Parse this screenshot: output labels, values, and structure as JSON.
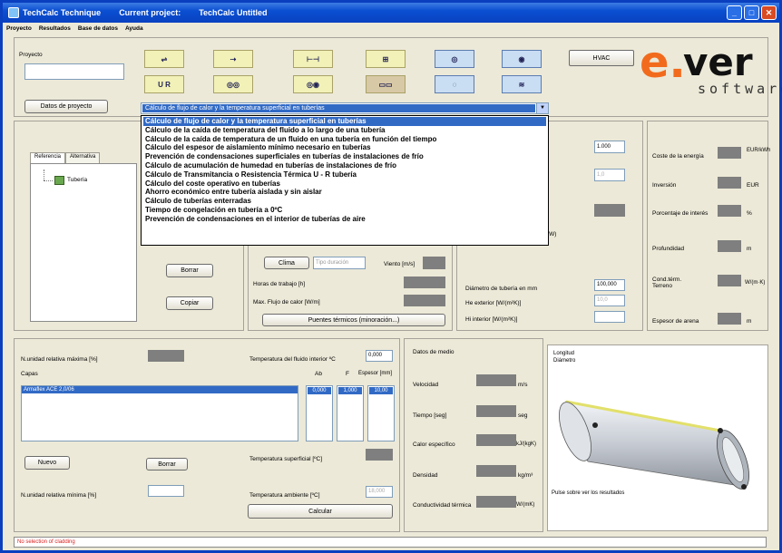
{
  "window": {
    "app_name": "TechCalc Technique",
    "project_label": "Current project:",
    "project_name": "TechCalc Untitled",
    "minimize": "_",
    "maximize": "□",
    "close": "✕"
  },
  "menu": [
    "Proyecto",
    "Resultados",
    "Base de datos",
    "Ayuda"
  ],
  "project": {
    "label": "Proyecto",
    "value": "",
    "data_button": "Datos de proyecto"
  },
  "toolbar": {
    "tools": [
      {
        "glyph": "⇌",
        "icon": "pipe-flow-icon"
      },
      {
        "glyph": "⇢",
        "icon": "pipe-arrow-icon"
      },
      {
        "glyph": "⊢⊣",
        "icon": "pipe-section-icon"
      },
      {
        "glyph": "⊞",
        "icon": "pipe-grid-icon"
      },
      {
        "glyph": "◎",
        "icon": "pipe-round-icon"
      },
      {
        "glyph": "◉",
        "icon": "pipe-ring-icon"
      },
      {
        "glyph": "U R",
        "icon": "ur-icon"
      },
      {
        "glyph": "◎◎",
        "icon": "double-pipe-icon"
      },
      {
        "glyph": "◎◉",
        "icon": "pipe-pair-icon"
      },
      {
        "glyph": "▭▭",
        "icon": "duct-icon"
      },
      {
        "glyph": "◌",
        "icon": "buried-pipe-icon"
      },
      {
        "glyph": "≋",
        "icon": "insulation-icon"
      }
    ],
    "hvac_label": "HVAC"
  },
  "logo": {
    "e": "e.",
    "ver": "ver",
    "sub": "software"
  },
  "combo": {
    "selected": "Cálculo de flujo de calor y la temperatura superficial en tuberías",
    "arrow": "▼"
  },
  "dropdown_items": [
    "Cálculo de flujo de calor y la temperatura superficial en tuberías",
    "Cálculo de la caída de temperatura del fluido a lo largo de una tubería",
    "Cálculo de la caída de temperatura de un fluido en una tubería en función del tiempo",
    "Cálculo del espesor de aislamiento mínimo necesario en tuberías",
    "Prevención de condensaciones superficiales en tuberías de instalaciones de frío",
    "Cálculo de acumulación de humedad en tuberías de instalaciones de frío",
    "Cálculo de Transmitancia o Resistencia Térmica U - R tubería",
    "Cálculo del coste operativo en tuberías",
    "Ahorro económico entre tubería aislada y sin aislar",
    "Cálculo de tuberías enterradas",
    "Tiempo de congelación en tubería a 0ºC",
    "Prevención de condensaciones en el interior de tuberías de aire"
  ],
  "tabs": {
    "referencia": "Referencia",
    "alternativa": "Alternativa"
  },
  "tree": {
    "item": "Tubería"
  },
  "buttons": {
    "borrar_1": "Borrar",
    "copiar": "Copiar",
    "clima": "Clima",
    "puentes": "Puentes térmicos (minoración...)",
    "nuevo": "Nuevo",
    "borrar_2": "Borrar",
    "calcular": "Calcular"
  },
  "climate": {
    "placeholder": "Tipo duración",
    "viento_label": "Viento [m/s]",
    "horas_label": "Horas de trabajo [h]",
    "flujo_label": "Max. Flujo de calor [W/m]"
  },
  "mid_right": {
    "value_1": "1.000",
    "value_2": "1,0",
    "partial_label": "(W)",
    "diametro_label": "Diámetro de tubería en mm",
    "diametro_value": "100,000",
    "he_label": "He exterior [W/(m²K)]",
    "he_value": "10,0",
    "hi_label": "Hi interior [W/(m²K)]"
  },
  "costs": {
    "coste_label": "Coste de la energía",
    "coste_unit": "EUR/kWh",
    "inversion_label": "Inversión",
    "inversion_unit": "EUR",
    "porcentaje_label": "Porcentaje de interés",
    "porcentaje_unit": "%",
    "profundidad_label": "Profundidad",
    "profundidad_unit": "m",
    "cond_label": "Cond.térm. Terreno",
    "cond_unit": "W/(m·K)",
    "espesor_label": "Espesor de arena",
    "espesor_unit": "m"
  },
  "layers": {
    "n_max_label": "N.unidad relativa máxima [%]",
    "capas_label": "Capas",
    "temp_fluido_label": "Temperatura del fluido interior ºC",
    "temp_fluido_value": "0,000",
    "col_ab": "Ab",
    "col_f": "F",
    "col_espesor": "Espesor [mm]",
    "layer_name": "Armaflex ACE 2,0/06",
    "row_v1": "0,000",
    "row_v2": "1,000",
    "row_v3": "10,00",
    "temp_sup_label": "Temperatura superficial [ºC]",
    "n_min_label": "N.unidad relativa mínima [%]",
    "temp_amb_label": "Temperatura ambiente [ºC]",
    "temp_amb_value": "18,000"
  },
  "medium": {
    "title": "Datos de medio",
    "velocidad_label": "Velocidad",
    "velocidad_unit": "m/s",
    "tiempo_label": "Tiempo [seg]",
    "tiempo_unit": "seg",
    "calor_label": "Calor específico",
    "calor_unit": "kJ/(kgK)",
    "densidad_label": "Densidad",
    "densidad_unit": "kg/m³",
    "conduct_label": "Conductividad térmica",
    "conduct_unit": "W/(mK)"
  },
  "diagram": {
    "legend_1": "Longitud",
    "legend_2": "Diámetro",
    "hint": "Pulse sobre ver los resultados"
  },
  "status": "No selection of cladding",
  "colors": {
    "title_blue": "#0b4fd2",
    "selection": "#316ac5",
    "logo_orange": "#f26b1d"
  }
}
